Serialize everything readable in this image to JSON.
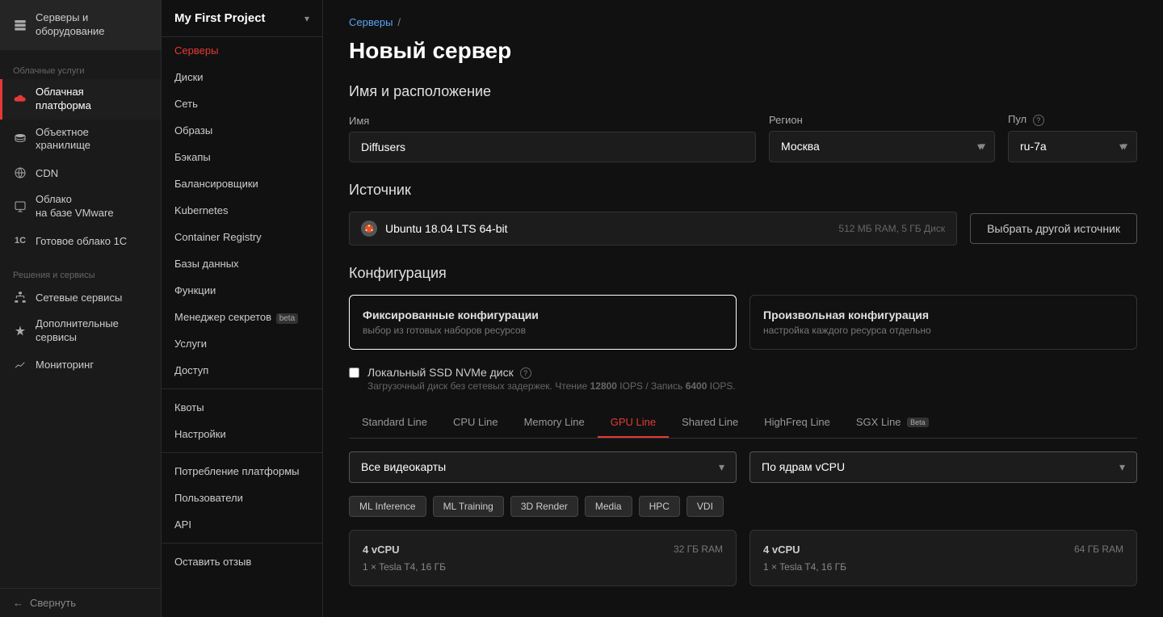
{
  "sidebar": {
    "sections": [
      {
        "label": null,
        "items": [
          {
            "id": "servers",
            "label": "Серверы и оборудование",
            "icon": "server-icon",
            "active": false
          }
        ]
      },
      {
        "label": "Облачные услуги",
        "items": [
          {
            "id": "cloud-platform",
            "label": "Облачная платформа",
            "icon": "cloud-icon",
            "active": true
          },
          {
            "id": "object-storage",
            "label": "Объектное хранилище",
            "icon": "storage-icon",
            "active": false
          },
          {
            "id": "cdn",
            "label": "CDN",
            "icon": "cdn-icon",
            "active": false
          },
          {
            "id": "vmware",
            "label": "Облако на базе VMware",
            "icon": "vmware-icon",
            "active": false
          },
          {
            "id": "1c",
            "label": "Готовое облако 1С",
            "icon": "1c-icon",
            "active": false
          }
        ]
      },
      {
        "label": "Решения и сервисы",
        "items": [
          {
            "id": "network-services",
            "label": "Сетевые сервисы",
            "icon": "network-icon",
            "active": false
          },
          {
            "id": "extra-services",
            "label": "Дополнительные сервисы",
            "icon": "extra-icon",
            "active": false
          },
          {
            "id": "monitoring",
            "label": "Мониторинг",
            "icon": "monitoring-icon",
            "active": false
          }
        ]
      }
    ],
    "collapse_label": "Свернуть"
  },
  "middle_nav": {
    "project_title": "My First Project",
    "items": [
      {
        "id": "servers",
        "label": "Серверы",
        "active": true
      },
      {
        "id": "disks",
        "label": "Диски",
        "active": false
      },
      {
        "id": "network",
        "label": "Сеть",
        "active": false
      },
      {
        "id": "images",
        "label": "Образы",
        "active": false
      },
      {
        "id": "backups",
        "label": "Бэкапы",
        "active": false
      },
      {
        "id": "balancers",
        "label": "Балансировщики",
        "active": false
      },
      {
        "id": "kubernetes",
        "label": "Kubernetes",
        "active": false
      },
      {
        "id": "container-registry",
        "label": "Container Registry",
        "active": false
      },
      {
        "id": "databases",
        "label": "Базы данных",
        "active": false
      },
      {
        "id": "functions",
        "label": "Функции",
        "active": false
      },
      {
        "id": "secrets-manager",
        "label": "Менеджер секретов",
        "active": false,
        "badge": "beta"
      },
      {
        "id": "services",
        "label": "Услуги",
        "active": false
      },
      {
        "id": "access",
        "label": "Доступ",
        "active": false
      }
    ],
    "bottom_items": [
      {
        "id": "quotas",
        "label": "Квоты"
      },
      {
        "id": "settings",
        "label": "Настройки"
      }
    ],
    "extra_items": [
      {
        "id": "platform-usage",
        "label": "Потребление платформы"
      },
      {
        "id": "users",
        "label": "Пользователи"
      },
      {
        "id": "api",
        "label": "API"
      }
    ],
    "feedback": "Оставить отзыв"
  },
  "main": {
    "breadcrumb": {
      "parent": "Серверы",
      "separator": "/"
    },
    "page_title": "Новый сервер",
    "name_section": {
      "title": "Имя и расположение",
      "name_label": "Имя",
      "name_value": "Diffusers",
      "name_placeholder": "Diffusers",
      "region_label": "Регион",
      "region_value": "Москва",
      "pool_label": "Пул",
      "pool_value": "ru-7a"
    },
    "source_section": {
      "title": "Источник",
      "source_name": "Ubuntu 18.04 LTS 64-bit",
      "source_meta": "512 МБ RAM, 5 ГБ Диск",
      "change_button": "Выбрать другой источник"
    },
    "config_section": {
      "title": "Конфигурация",
      "cards": [
        {
          "id": "fixed",
          "title": "Фиксированные конфигурации",
          "desc": "выбор из готовых наборов ресурсов",
          "active": true
        },
        {
          "id": "custom",
          "title": "Произвольная конфигурация",
          "desc": "настройка каждого ресурса отдельно",
          "active": false
        }
      ],
      "local_ssd": {
        "label": "Локальный SSD NVMe диск",
        "desc": "Загрузочный диск без сетевых задержек. Чтение 12800 IOPS / Запись 6400 IOPS.",
        "read_iops": "12800",
        "write_iops": "6400"
      }
    },
    "tabs": [
      {
        "id": "standard",
        "label": "Standard Line",
        "active": false
      },
      {
        "id": "cpu",
        "label": "CPU Line",
        "active": false
      },
      {
        "id": "memory",
        "label": "Memory Line",
        "active": false
      },
      {
        "id": "gpu",
        "label": "GPU Line",
        "active": true
      },
      {
        "id": "shared",
        "label": "Shared Line",
        "active": false
      },
      {
        "id": "highfreq",
        "label": "HighFreq Line",
        "active": false
      },
      {
        "id": "sgx",
        "label": "SGX Line",
        "active": false,
        "badge": "Beta"
      }
    ],
    "gpu_filter": {
      "video_card_placeholder": "Все видеокарты",
      "sort_placeholder": "По ядрам vCPU"
    },
    "gpu_tags": [
      {
        "id": "ml-inference",
        "label": "ML Inference"
      },
      {
        "id": "ml-training",
        "label": "ML Training"
      },
      {
        "id": "3d-render",
        "label": "3D Render"
      },
      {
        "id": "media",
        "label": "Media"
      },
      {
        "id": "hpc",
        "label": "HPC"
      },
      {
        "id": "vdi",
        "label": "VDI"
      }
    ],
    "server_cards": [
      {
        "vcpu": "4 vCPU",
        "ram": "32 ГБ RAM",
        "gpu": "1 × Tesla T4, 16 ГБ"
      },
      {
        "vcpu": "4 vCPU",
        "ram": "64 ГБ RAM",
        "gpu": "1 × Tesla T4, 16 ГБ"
      }
    ]
  }
}
